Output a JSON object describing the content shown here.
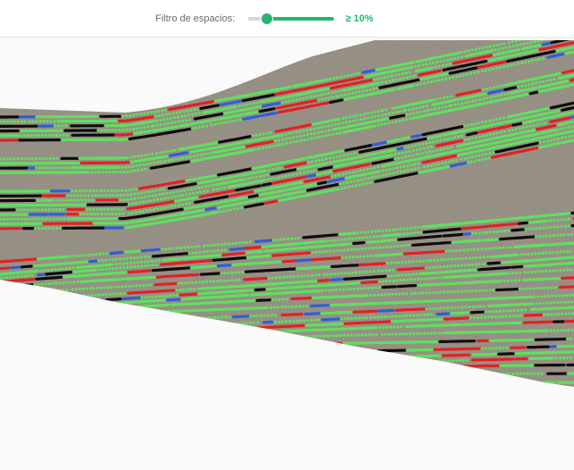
{
  "filter": {
    "label": "Filtro de espacios:",
    "value_text": "≥ 10%",
    "slider_value_fraction": 0.22
  },
  "legend_colors": {
    "accent": "#22b573",
    "row_green": "#5fe05f",
    "row_red": "#e02222",
    "row_blue": "#2e5fd6",
    "row_black": "#0d0d0d",
    "soil": "#8f867a"
  },
  "map": {
    "kind": "field-planting-gap-map"
  }
}
